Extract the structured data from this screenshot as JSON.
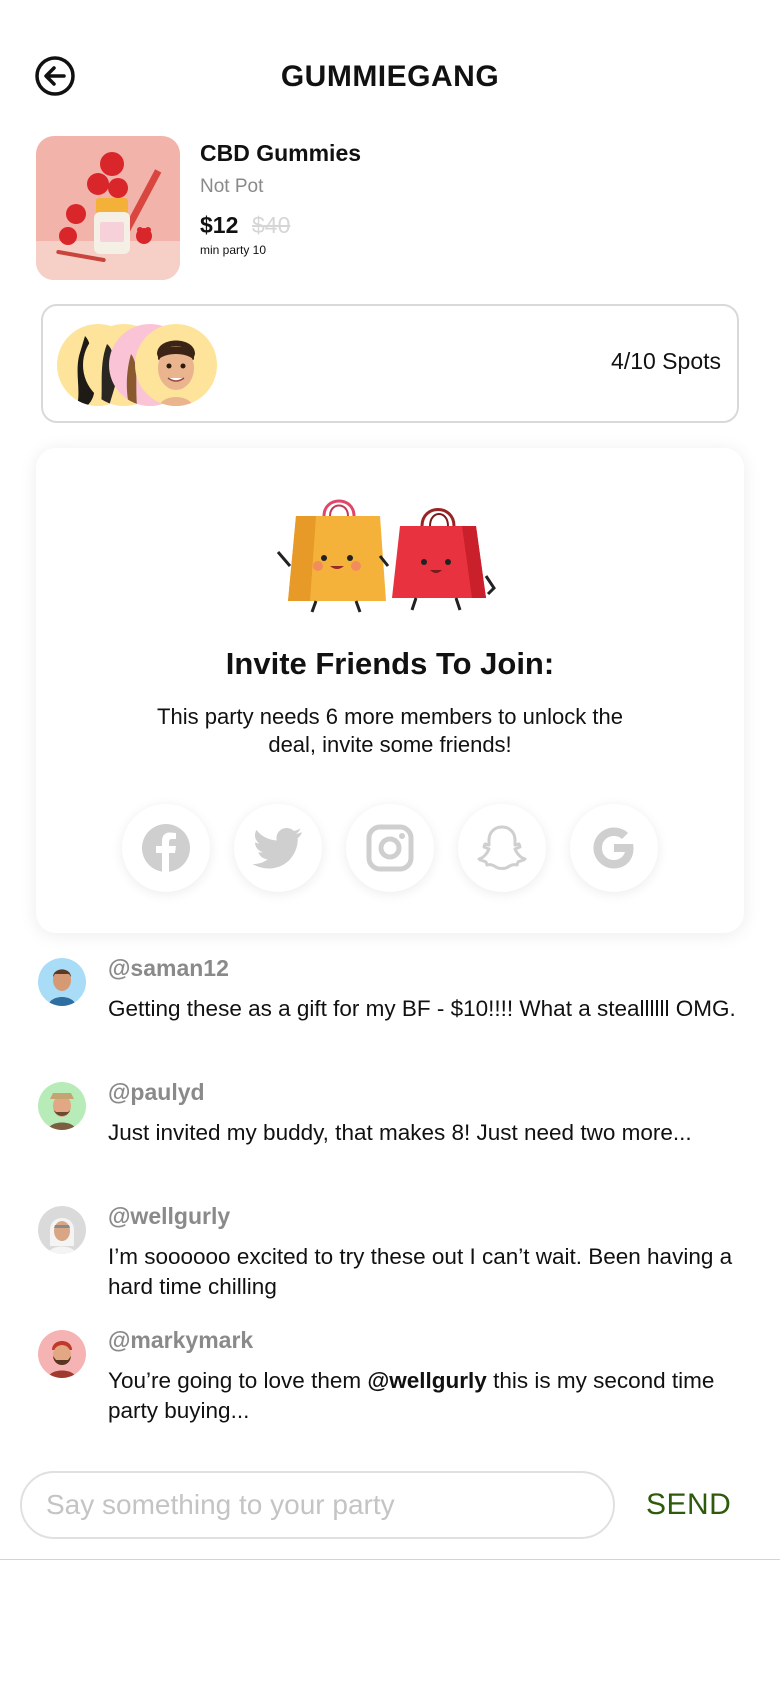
{
  "header": {
    "title": "GUMMIEGANG",
    "back_icon": "back-arrow-icon"
  },
  "product": {
    "name": "CBD Gummies",
    "brand": "Not Pot",
    "price": "$12",
    "old_price": "$40",
    "min_party": "min party 10"
  },
  "spots": {
    "text": "4/10 Spots"
  },
  "invite": {
    "title": "Invite Friends To Join:",
    "body": "This party needs 6 more members to unlock the deal, invite some friends!",
    "socials": [
      "facebook-icon",
      "twitter-icon",
      "instagram-icon",
      "snapchat-icon",
      "google-icon"
    ]
  },
  "comments": [
    {
      "user": "@saman12",
      "text": "Getting these as a gift for my BF - $10!!!! What a steallllll OMG.",
      "avatar_color": "#a9dcf7"
    },
    {
      "user": "@paulyd",
      "text": "Just invited my buddy, that makes 8! Just need two more...",
      "avatar_color": "#b7ecb9"
    },
    {
      "user": "@wellgurly",
      "text": "I’m soooooo excited to try these out I can’t wait. Been having a hard time chilling",
      "avatar_color": "#dadada"
    },
    {
      "user": "@markymark",
      "text_before": "You’re going to love them ",
      "mention": "@wellgurly",
      "text_after": " this is my second time party buying...",
      "avatar_color": "#f6b3b3"
    }
  ],
  "composer": {
    "placeholder": "Say something to your party",
    "send_label": "SEND"
  },
  "colors": {
    "send": "#2e5a0c",
    "muted": "#8a8a8a",
    "border": "#d9d9d9",
    "avatar_yellow": "#fde49a",
    "avatar_pink": "#fbc3d6"
  }
}
